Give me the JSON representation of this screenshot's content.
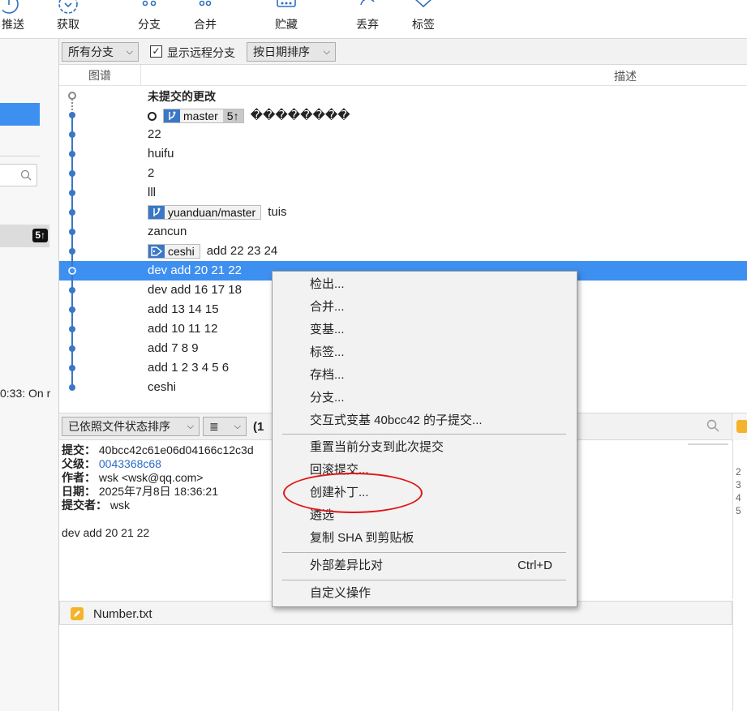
{
  "toolbar": {
    "push": "推送",
    "fetch": "获取",
    "branch": "分支",
    "merge": "合并",
    "stash": "贮藏",
    "discard": "丢弃",
    "tag": "标签"
  },
  "left": {
    "badge": "5↑",
    "status": "0:33: On r"
  },
  "filters": {
    "branches": "所有分支",
    "show_remote": "显示远程分支",
    "sort": "按日期排序",
    "arrow": "⌵",
    "check": "✓"
  },
  "columns": {
    "graph": "图谱",
    "description": "描述"
  },
  "commits": [
    {
      "msg": "未提交的更改"
    },
    {
      "msg": "��������",
      "ref": "master",
      "count": "5↑"
    },
    {
      "msg": "22"
    },
    {
      "msg": "huifu"
    },
    {
      "msg": "2"
    },
    {
      "msg": "lll"
    },
    {
      "msg": "tuis",
      "ref": "yuanduan/master"
    },
    {
      "msg": "zancun"
    },
    {
      "msg": "add 22 23 24",
      "ref": "ceshi"
    },
    {
      "msg": "dev add 20 21 22"
    },
    {
      "msg": "dev add 16 17 18"
    },
    {
      "msg": "add 13 14 15"
    },
    {
      "msg": "add 10 11 12"
    },
    {
      "msg": "add 7 8 9"
    },
    {
      "msg": "add 1 2 3 4 5 6"
    },
    {
      "msg": "ceshi"
    }
  ],
  "files": {
    "sort": "已依照文件状态排序",
    "view": "≣",
    "count": "(1"
  },
  "detail": {
    "sha_label": "提交：",
    "sha": "40bcc42c61e06d04166c12c3d",
    "parent_label": "父级：",
    "parent": "0043368c68",
    "author_label": "作者：",
    "author": "wsk <wsk@qq.com>",
    "date_label": "日期：",
    "date": "2025年7月8日 18:36:21",
    "committer_label": "提交者：",
    "committer": "wsk",
    "message": "dev add 20 21 22"
  },
  "gutter": [
    "2",
    "3",
    "4",
    "5"
  ],
  "file_tab": "Number.txt",
  "menu": {
    "checkout": "检出...",
    "merge": "合并...",
    "rebase": "变基...",
    "tag": "标签...",
    "archive": "存档...",
    "branch": "分支...",
    "interactive_rebase": "交互式变基 40bcc42 的子提交...",
    "reset": "重置当前分支到此次提交",
    "revert": "回滚提交...",
    "create_patch": "创建补丁...",
    "cherry_pick": "遴选",
    "copy_sha": "复制 SHA 到剪贴板",
    "external_diff": "外部差异比对",
    "external_diff_shortcut": "Ctrl+D",
    "custom_action": "自定义操作"
  }
}
